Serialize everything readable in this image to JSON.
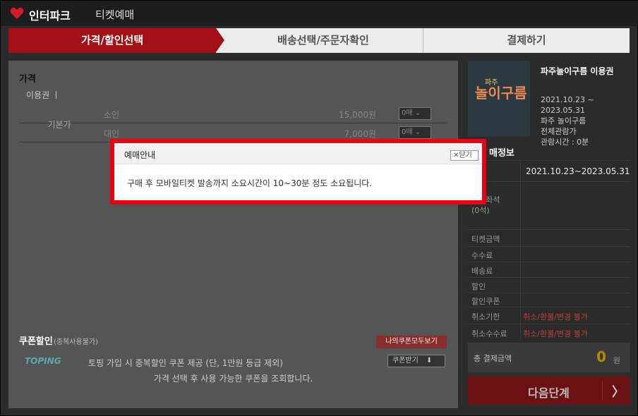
{
  "header": {
    "brand": "인터파크",
    "brand_sub": "티켓예매"
  },
  "steps": [
    {
      "label": "가격/할인선택",
      "active": true
    },
    {
      "label": "배송선택/주문자확인",
      "active": false
    },
    {
      "label": "결제하기",
      "active": false
    }
  ],
  "price": {
    "section_title": "가격",
    "ticket_type": "이용권 ㅣ",
    "group_label": "기본가",
    "rows": [
      {
        "name": "소인",
        "amount": "15,000원",
        "qty": "0매"
      },
      {
        "name": "대인",
        "amount": "7,000원",
        "qty": "0매"
      }
    ]
  },
  "coupon": {
    "title": "쿠폰할인",
    "subtitle": "(중복사용불가)",
    "view_all_button": "나의쿠폰모두보기",
    "brand": "TOPING",
    "desc": "토핑 가입 시 중복할인 쿠폰 제공 (단, 1만원 등급 제외)",
    "receive_button": "쿠폰받기",
    "info": "가격 선택 후 사용 가능한 쿠폰을 조회합니다."
  },
  "product": {
    "poster_line1": "파주",
    "poster_line2": "놀이구름",
    "title": "파주놀이구름 이용권",
    "date_range": "2021.10.23 ~",
    "date_end": "2023.05.31",
    "venue": "파주 놀이구름",
    "rating": "전체관람가",
    "runtime": "관람시간 : 0분"
  },
  "booking_info": {
    "title": "매정보",
    "rows": [
      {
        "label": "",
        "value": "2021.10.23~2023.05.31"
      },
      {
        "label": "선택좌석\n(0석)",
        "value": ""
      },
      {
        "label": "티켓금액",
        "value": ""
      },
      {
        "label": "수수료",
        "value": ""
      },
      {
        "label": "배송료",
        "value": ""
      },
      {
        "label": "할인",
        "value": ""
      },
      {
        "label": "할인쿠폰",
        "value": ""
      },
      {
        "label": "취소기한",
        "value": "취소/환불/변경 불가"
      },
      {
        "label": "취소수수료",
        "value": "취소/환불/변경 불가"
      }
    ],
    "total_label": "총 결제금액",
    "total_value": "0",
    "total_unit": "원",
    "next_button": "다음단계"
  },
  "dialog": {
    "title": "예매안내",
    "close_label": "닫기",
    "message": "구매 후 모바일티켓 발송까지 소요시간이 10~30분 정도 소요됩니다."
  },
  "colors": {
    "accent": "#a20f16",
    "dialog_border": "#e60012",
    "total": "#b58a00"
  }
}
